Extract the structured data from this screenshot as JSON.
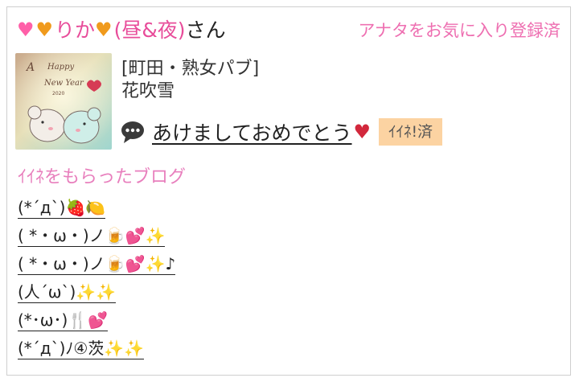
{
  "user": {
    "name": "りか",
    "time_tag": "(昼&夜)",
    "suffix": "さん"
  },
  "favorite_status": "アナタをお気に入り登録済",
  "post": {
    "shop": "[町田・熟女パブ]",
    "girl": "花吹雪",
    "title": "あけましておめでとう",
    "iine_badge": "ｲｲﾈ!済",
    "thumbnail_text": "A Happy New Year 2020"
  },
  "section_title": "ｲｲﾈをもらったブログ",
  "blogs": [
    {
      "text": "(*´д`)",
      "emoji": "🍓🍋"
    },
    {
      "text": "( *・ω・)ノ",
      "emoji": "🍺💕✨"
    },
    {
      "text": "( *・ω・)ノ",
      "emoji": "🍺💕✨♪"
    },
    {
      "text": "(人´ω`)",
      "emoji": "✨✨"
    },
    {
      "text": "(*･ω･)",
      "emoji": "🍴💕"
    },
    {
      "text": "(*´д`)ﾉ④茨",
      "emoji": "✨✨"
    }
  ],
  "colors": {
    "accent_pink": "#e87fbd",
    "name_pink": "#e84c9a",
    "badge_bg": "#fcd3a2",
    "border": "#cfcfcf"
  }
}
